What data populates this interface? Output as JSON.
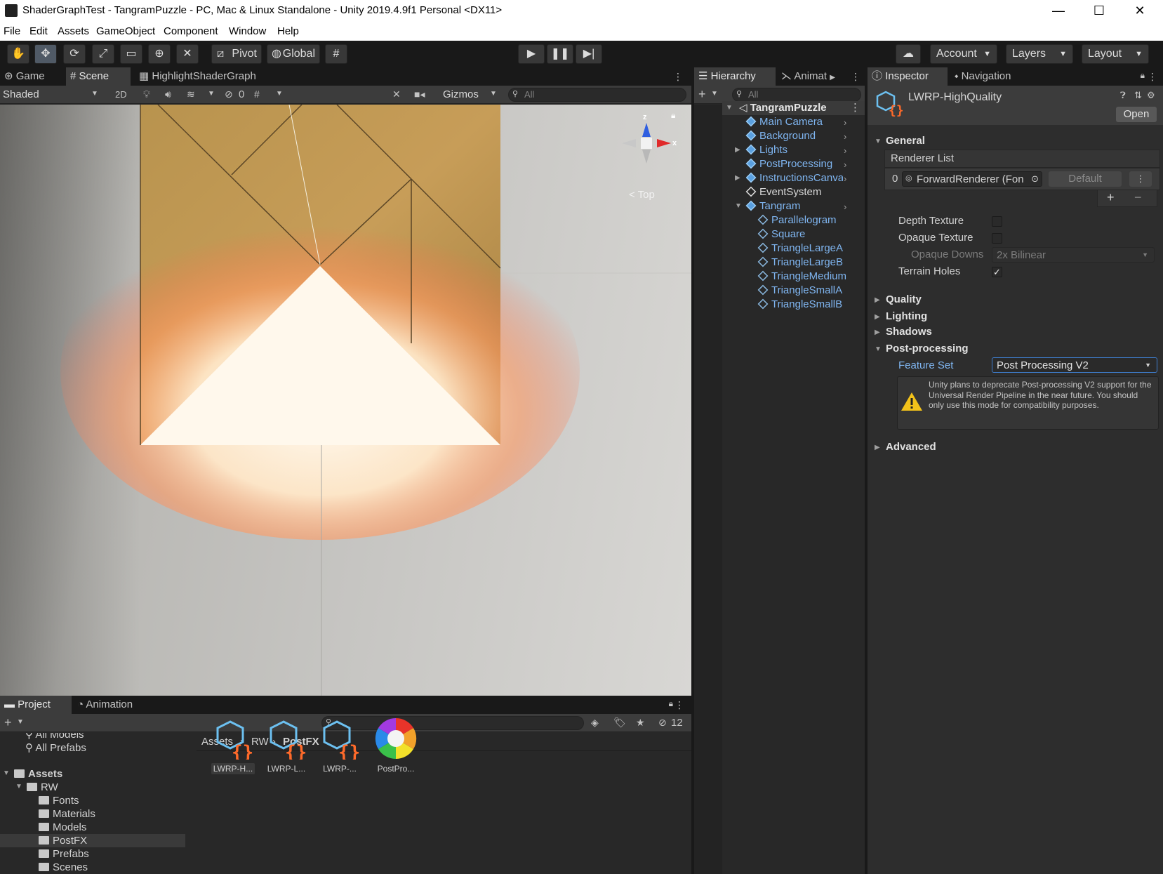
{
  "window": {
    "title": "ShaderGraphTest - TangramPuzzle - PC, Mac & Linux Standalone - Unity 2019.4.9f1 Personal <DX11>",
    "minimize": "—",
    "maximize": "☐",
    "close": "✕"
  },
  "menu": [
    "File",
    "Edit",
    "Assets",
    "GameObject",
    "Component",
    "Window",
    "Help"
  ],
  "toolbar": {
    "pivot": "Pivot",
    "global": "Global",
    "account": "Account",
    "layers": "Layers",
    "layout": "Layout"
  },
  "scene_panel": {
    "tabs": [
      "Game",
      "Scene",
      "HighlightShaderGraph"
    ],
    "shading_mode": "Shaded",
    "mode_2d": "2D",
    "hidden_count": "0",
    "gizmos": "Gizmos",
    "search_placeholder": "All",
    "gizmo_view": "Top",
    "axis_z": "z",
    "axis_x": "x"
  },
  "hierarchy": {
    "tabs": [
      "Hierarchy",
      "Animat"
    ],
    "search_placeholder": "All",
    "scene_name": "TangramPuzzle",
    "items": [
      {
        "label": "Main Camera"
      },
      {
        "label": "Background"
      },
      {
        "label": "Lights"
      },
      {
        "label": "PostProcessing"
      },
      {
        "label": "InstructionsCanva"
      },
      {
        "label": "EventSystem"
      },
      {
        "label": "Tangram"
      }
    ],
    "children": [
      "Parallelogram",
      "Square",
      "TriangleLargeA",
      "TriangleLargeB",
      "TriangleMedium",
      "TriangleSmallA",
      "TriangleSmallB"
    ]
  },
  "inspector": {
    "tabs": [
      "Inspector",
      "Navigation"
    ],
    "asset_name": "LWRP-HighQuality",
    "open_button": "Open",
    "sections": {
      "general": "General",
      "quality": "Quality",
      "lighting": "Lighting",
      "shadows": "Shadows",
      "post_processing": "Post-processing",
      "advanced": "Advanced"
    },
    "renderer_list_label": "Renderer List",
    "renderer_index": "0",
    "renderer_value": "ForwardRenderer (Fon",
    "renderer_default": "Default",
    "add": "+",
    "remove": "−",
    "depth_texture": "Depth Texture",
    "opaque_texture": "Opaque Texture",
    "opaque_downsampling": "Opaque Downs",
    "opaque_downsampling_value": "2x Bilinear",
    "terrain_holes": "Terrain Holes",
    "terrain_holes_checked": "✓",
    "feature_set_label": "Feature Set",
    "feature_set_value": "Post Processing V2",
    "warning": "Unity plans to deprecate Post-processing V2 support for the Universal Render Pipeline in the near future. You should only use this mode for compatibility purposes."
  },
  "project": {
    "tabs": [
      "Project",
      "Animation"
    ],
    "hidden_count": "12",
    "favorites": [
      "All Models",
      "All Prefabs"
    ],
    "root": "Assets",
    "rw": "RW",
    "folders": [
      "Fonts",
      "Materials",
      "Models",
      "PostFX",
      "Prefabs",
      "Scenes"
    ],
    "breadcrumb": [
      "Assets",
      "RW",
      "PostFX"
    ],
    "assets": [
      "LWRP-H...",
      "LWRP-L...",
      "LWRP-...",
      "PostPro..."
    ]
  },
  "colors": {
    "accent_blue": "#7fb5f0",
    "asset_orange": "#ff6a2a",
    "panel_bg": "#282828",
    "tab_bar": "#191919"
  }
}
